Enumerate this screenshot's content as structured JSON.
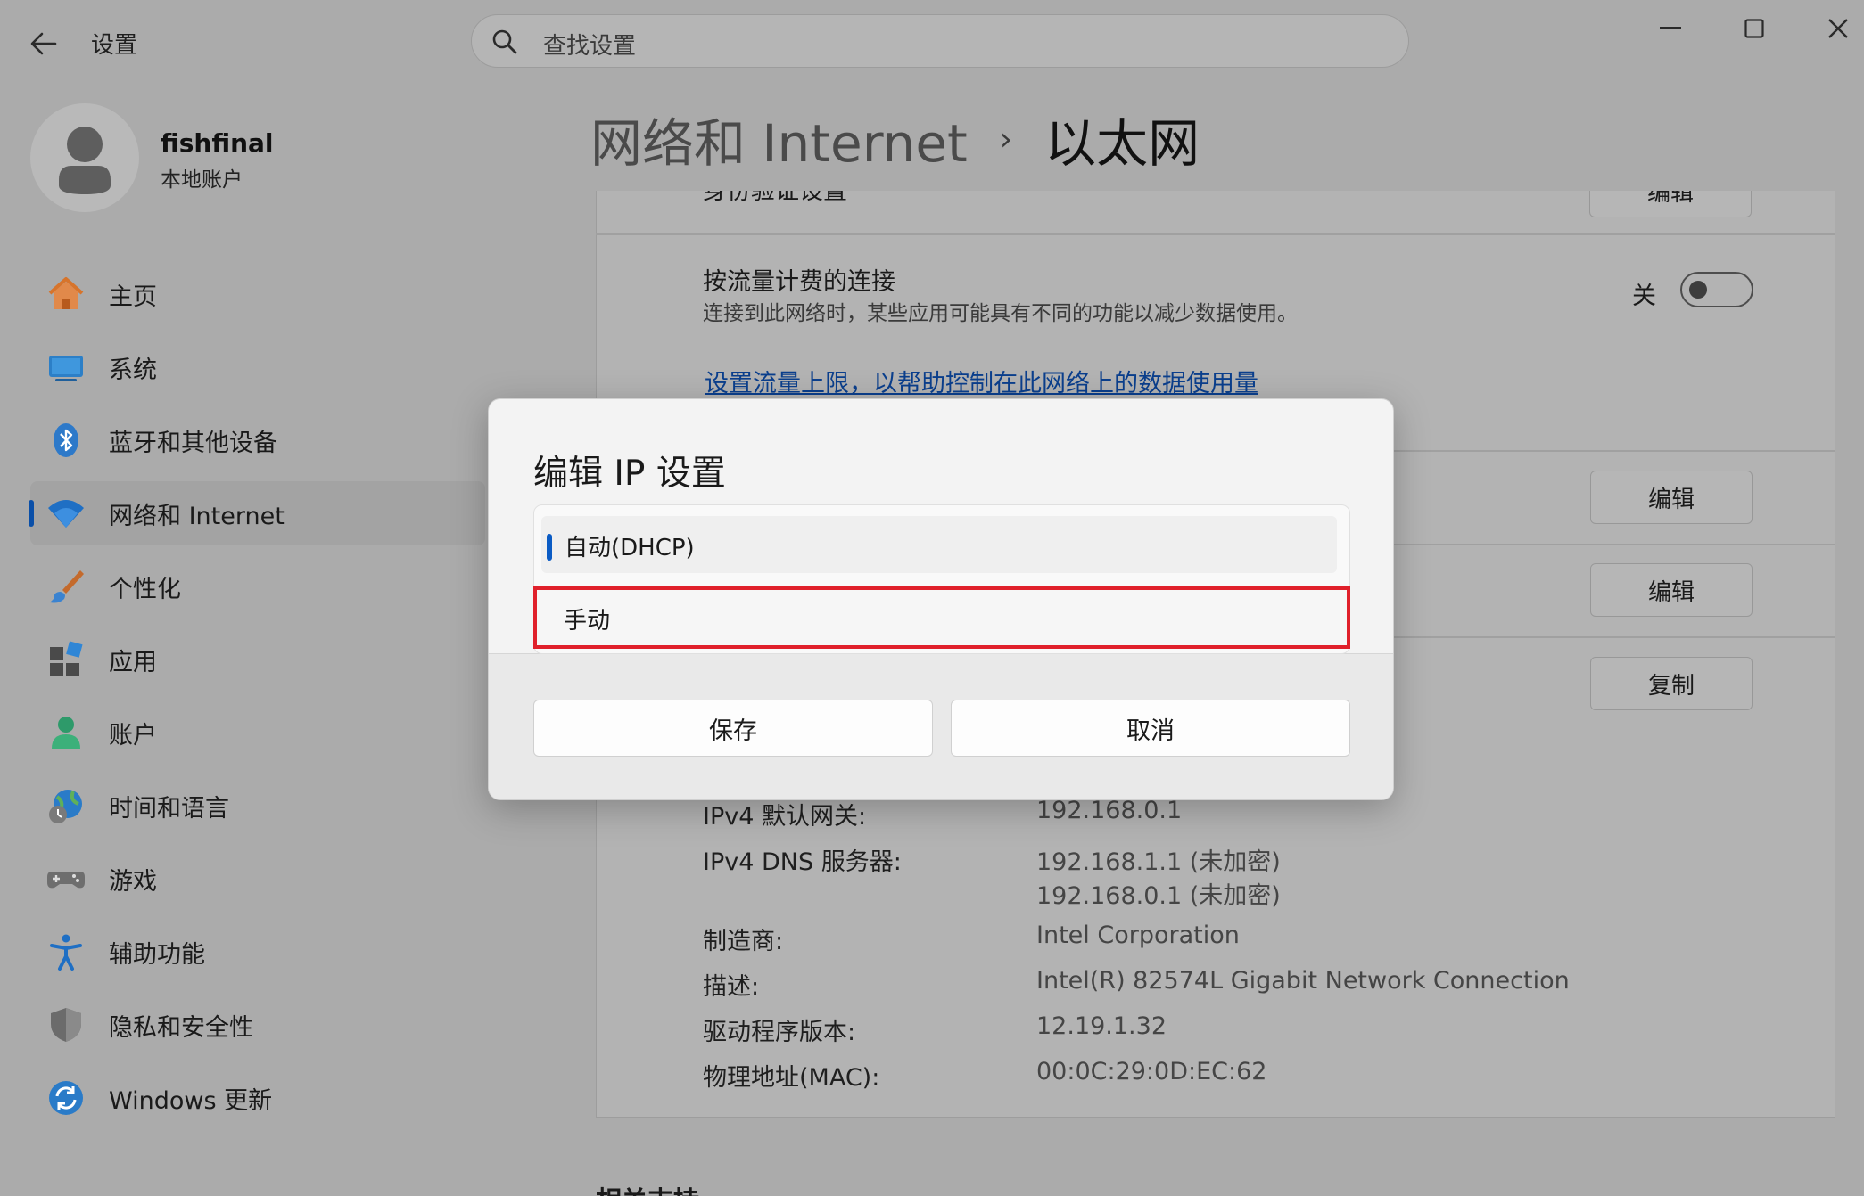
{
  "window": {
    "title": "设置",
    "search_placeholder": "查找设置"
  },
  "profile": {
    "name": "fishfinal",
    "account_type": "本地账户"
  },
  "nav": [
    {
      "label": "主页",
      "icon": "home-icon"
    },
    {
      "label": "系统",
      "icon": "monitor-icon"
    },
    {
      "label": "蓝牙和其他设备",
      "icon": "bluetooth-icon"
    },
    {
      "label": "网络和 Internet",
      "icon": "wifi-icon",
      "active": true
    },
    {
      "label": "个性化",
      "icon": "brush-icon"
    },
    {
      "label": "应用",
      "icon": "apps-icon"
    },
    {
      "label": "账户",
      "icon": "person-icon"
    },
    {
      "label": "时间和语言",
      "icon": "globe-clock-icon"
    },
    {
      "label": "游戏",
      "icon": "gamepad-icon"
    },
    {
      "label": "辅助功能",
      "icon": "accessibility-icon"
    },
    {
      "label": "隐私和安全性",
      "icon": "shield-icon"
    },
    {
      "label": "Windows 更新",
      "icon": "update-icon"
    }
  ],
  "header": {
    "parent": "网络和 Internet",
    "separator": "›",
    "current": "以太网"
  },
  "content": {
    "auth_row_title": "身份验证设置",
    "metered": {
      "title": "按流量计费的连接",
      "subtitle": "连接到此网络时，某些应用可能具有不同的功能以减少数据使用。",
      "state_label": "关",
      "state": false
    },
    "data_limit_link": "设置流量上限，以帮助控制在此网络上的数据使用量",
    "buttons": {
      "edit": "编辑",
      "edit2": "编辑",
      "edit3": "编辑",
      "copy": "复制"
    },
    "properties": [
      {
        "label": "IPv4 默认网关:",
        "value": "192.168.0.1"
      },
      {
        "label": "IPv4 DNS 服务器:",
        "value": "192.168.1.1 (未加密)",
        "value2": "192.168.0.1 (未加密)"
      },
      {
        "label": "制造商:",
        "value": "Intel Corporation"
      },
      {
        "label": "描述:",
        "value": "Intel(R) 82574L Gigabit Network Connection"
      },
      {
        "label": "驱动程序版本:",
        "value": "12.19.1.32"
      },
      {
        "label": "物理地址(MAC):",
        "value": "00:0C:29:0D:EC:62"
      }
    ],
    "related_heading": "相关支持"
  },
  "dialog": {
    "title": "编辑 IP 设置",
    "options": [
      "自动(DHCP)",
      "手动"
    ],
    "selected_option": "自动(DHCP)",
    "save_label": "保存",
    "cancel_label": "取消",
    "highlight_color": "#e0202b"
  }
}
